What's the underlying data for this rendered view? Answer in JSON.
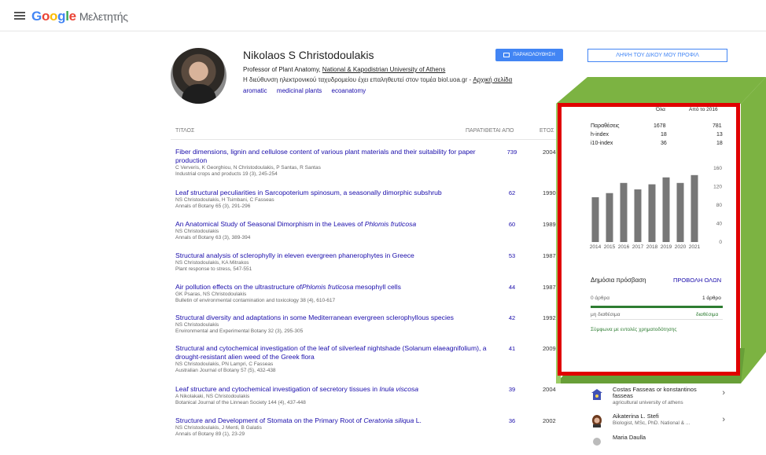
{
  "app": {
    "logo_google": "Google",
    "logo_product": "Μελετητής"
  },
  "profile": {
    "name": "Nikolaos S Christodoulakis",
    "title_prefix": "Professor of Plant Anatomy, ",
    "affiliation_link": "National & Kapodistrian University of Athens",
    "email_text": "Η διεύθυνση ηλεκτρονικού ταχυδρομείου έχει επαληθευτεί στον τομέα biol.uoa.gr - ",
    "homepage_link": "Αρχική σελίδα",
    "tags": [
      "aromatic",
      "medicinal plants",
      "ecoanatomy"
    ],
    "follow_label": "ΠΑΡΑΚΟΛΟΥΘΗΣΗ",
    "get_profile_label": "ΛΗΨΗ ΤΟΥ ΔΙΚΟΥ ΜΟΥ ΠΡΟΦΙΛ"
  },
  "table": {
    "col_title": "ΤΙΤΛΟΣ",
    "col_cited": "ΠΑΡΑΤΙΘΕΤΑΙ ΑΠΟ",
    "col_year": "ΕΤΟΣ"
  },
  "publications": [
    {
      "title": "Fiber dimensions, lignin and cellulose content of various plant materials and their suitability for paper production",
      "authors": "C Ververis, K Georghiou, N Christodoulakis, P Santas, R Santas",
      "journal": "Industrial crops and products 19 (3), 245-254",
      "cited": "739",
      "year": "2004"
    },
    {
      "title": "Leaf structural peculiarities in Sarcopoterium spinosum, a seasonally dimorphic subshrub",
      "authors": "NS Christodoulakis, H Tsimbani, C Fasseas",
      "journal": "Annals of Botany 65 (3), 291-296",
      "cited": "62",
      "year": "1990"
    },
    {
      "title_pre": "An Anatomical Study of Seasonal Dimorphism in the Leaves of ",
      "title_em": "Phlomis fruticosa",
      "authors": "NS Christodoulakis",
      "journal": "Annals of Botany 63 (3), 389-394",
      "cited": "60",
      "year": "1989"
    },
    {
      "title": "Structural analysis of sclerophylly in eleven evergreen phanerophytes in Greece",
      "authors": "NS Christodoulakis, KA Mitrakos",
      "journal": "Plant response to stress, 547-551",
      "cited": "53",
      "year": "1987"
    },
    {
      "title_pre": "Air pollution effects on the ultrastructure of",
      "title_em": "Phlomis fruticosa",
      "title_post": " mesophyll cells",
      "authors": "GK Psaras, NS Christodoulakis",
      "journal": "Bulletin of environmental contamination and toxicology 38 (4), 610-617",
      "cited": "44",
      "year": "1987"
    },
    {
      "title": "Structural diversity and adaptations in some Mediterranean evergreen sclerophyllous species",
      "authors": "NS Christodoulakis",
      "journal": "Environmental and Experimental Botany 32 (3), 295-305",
      "cited": "42",
      "year": "1992"
    },
    {
      "title": "Structural and cytochemical investigation of the leaf of silverleaf nightshade (Solanum elaeagnifolium), a drought-resistant alien weed of the Greek flora",
      "authors": "NS Christodoulakis, PN Lampri, C Fasseas",
      "journal": "Australian Journal of Botany 57 (5), 432-438",
      "cited": "41",
      "year": "2009"
    },
    {
      "title_pre": "Leaf structure and cytochemical investigation of secretory tissues in ",
      "title_em": "Inula viscosa",
      "authors": "A Nikolakaki, NS Christodoulakis",
      "journal": "Botanical Journal of the Linnean Society 144 (4), 437-448",
      "cited": "39",
      "year": "2004"
    },
    {
      "title_pre": "Structure and Development of Stomata on the Primary Root of ",
      "title_em": "Ceratonia siliqua",
      "title_post": " L.",
      "authors": "NS Christodoulakis, J Menti, B Galatis",
      "journal": "Annals of Botany 89 (1), 23-29",
      "cited": "36",
      "year": "2002"
    }
  ],
  "stats": {
    "col_all": "Όλα",
    "col_since": "Από το 2016",
    "rows": [
      {
        "label": "Παραθέσεις",
        "all": "1678",
        "since": "781"
      },
      {
        "label": "h-index",
        "all": "18",
        "since": "13"
      },
      {
        "label": "i10-index",
        "all": "36",
        "since": "18"
      }
    ]
  },
  "chart_data": {
    "type": "bar",
    "categories": [
      "2014",
      "2015",
      "2016",
      "2017",
      "2018",
      "2019",
      "2020",
      "2021"
    ],
    "values": [
      97,
      106,
      128,
      114,
      125,
      140,
      128,
      145
    ],
    "ylim": [
      0,
      160
    ],
    "yticks": [
      "160",
      "120",
      "80",
      "40",
      "0"
    ],
    "bar_color": "#777777"
  },
  "access": {
    "title": "Δημόσια πρόσβαση",
    "view_all": "ΠΡΟΒΟΛΗ ΟΛΩΝ",
    "unavailable_count": "0 άρθρα",
    "available_count": "1 άρθρο",
    "unavailable_label": "μη διαθέσιμα",
    "available_label": "διαθέσιμα",
    "mandates": "Σύμφωνα με εντολές χρηματοδότησης"
  },
  "coauthors": [
    {
      "name": "Costas Fasseas or konstantinos fasseas",
      "desc": "agricultural university of athens"
    },
    {
      "name": "Aikaterina L. Stefi",
      "desc": "Biologist, MSc, PhD. National & ..."
    },
    {
      "name": "Maria Daulla",
      "desc": ""
    }
  ],
  "colors": {
    "accent": "#4285f4",
    "link": "#1a0dab",
    "highlight_border": "#e00000",
    "box_green": "#7cb342"
  }
}
